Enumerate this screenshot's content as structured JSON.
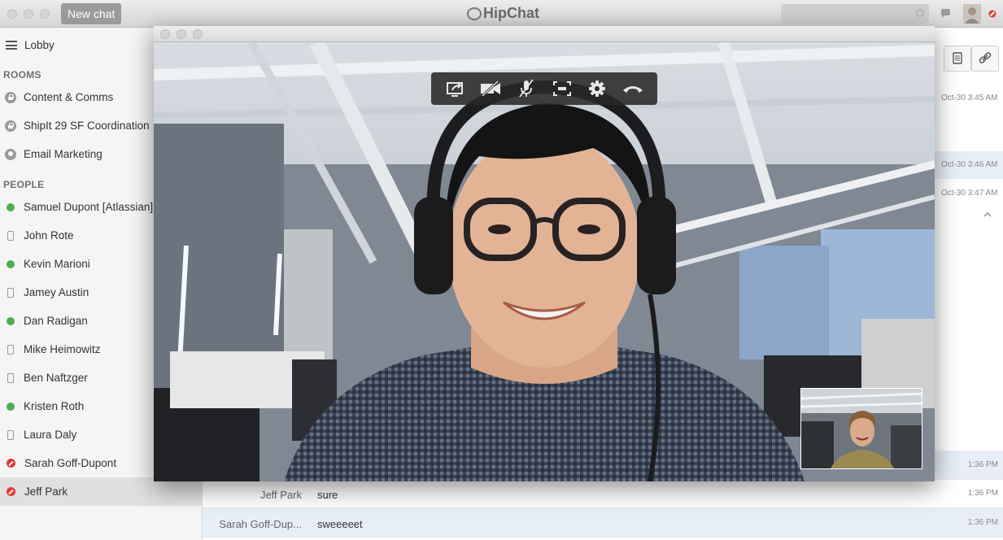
{
  "titlebar": {
    "new_chat_label": "New chat",
    "app_name": "HipChat"
  },
  "sidebar": {
    "lobby_label": "Lobby",
    "rooms_heading": "ROOMS",
    "rooms": [
      {
        "label": "Content & Comms",
        "icon": "lock-icon"
      },
      {
        "label": "ShipIt 29 SF Coordination",
        "icon": "lock-icon"
      },
      {
        "label": "Email Marketing",
        "icon": "group-icon"
      }
    ],
    "people_heading": "PEOPLE",
    "people": [
      {
        "label": "Samuel Dupont [Atlassian]",
        "status": "available"
      },
      {
        "label": "John Rote",
        "status": "mobile"
      },
      {
        "label": "Kevin Marioni",
        "status": "available"
      },
      {
        "label": "Jamey Austin",
        "status": "mobile"
      },
      {
        "label": "Dan Radigan",
        "status": "available"
      },
      {
        "label": "Mike Heimowitz",
        "status": "mobile"
      },
      {
        "label": "Ben Naftzger",
        "status": "mobile"
      },
      {
        "label": "Kristen Roth",
        "status": "available"
      },
      {
        "label": "Laura Daly",
        "status": "mobile"
      },
      {
        "label": "Sarah Goff-Dupont",
        "status": "do-not-disturb"
      },
      {
        "label": "Jeff Park",
        "status": "do-not-disturb",
        "selected": true
      }
    ]
  },
  "chat": {
    "timestamps": [
      "Oct-30 3:45 AM",
      "Oct-30 3:46 AM",
      "Oct-30 3:47 AM"
    ],
    "messages": [
      {
        "sender": "",
        "text": "",
        "time": "1:36 PM"
      },
      {
        "sender": "Jeff Park",
        "text": "sure",
        "time": "1:36 PM"
      },
      {
        "sender": "Sarah Goff-Dup...",
        "text": "sweeeeet",
        "time": "1:36 PM"
      }
    ]
  },
  "video_call": {
    "controls": [
      "share-screen-icon",
      "video-off-icon",
      "mute-icon",
      "fullscreen-icon",
      "settings-icon",
      "hang-up-icon"
    ]
  },
  "colors": {
    "available": "#4caf50",
    "dnd": "#e53935",
    "selected_row": "#e0e0e0",
    "highlight_row": "#e8eef8"
  }
}
